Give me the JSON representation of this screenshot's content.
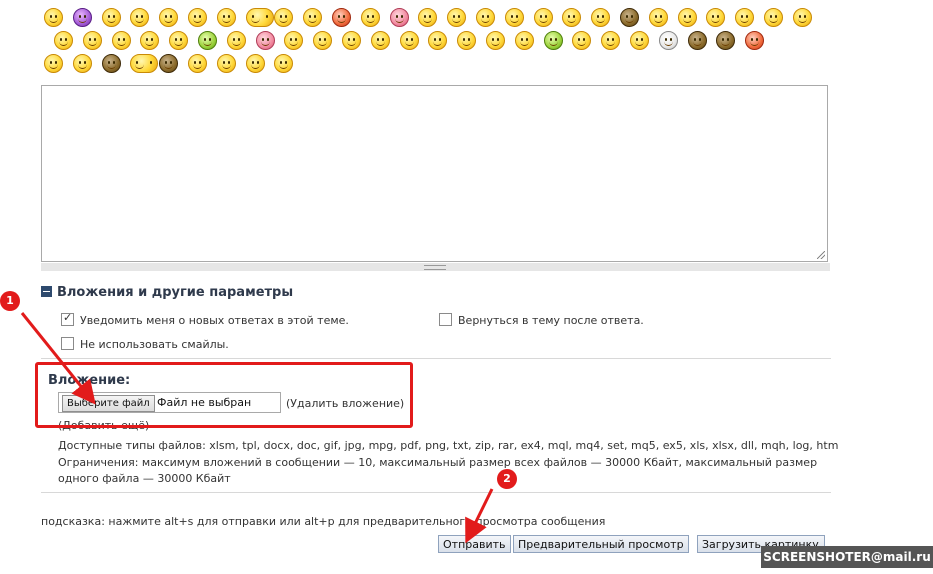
{
  "smileys": [
    {
      "kind": "yellow"
    },
    {
      "kind": "purple"
    },
    {
      "kind": "yellow"
    },
    {
      "kind": "yellow"
    },
    {
      "kind": "yellow"
    },
    {
      "kind": "yellow"
    },
    {
      "kind": "yellow"
    },
    {
      "kind": "yellow-wide"
    },
    {
      "kind": "yellow"
    },
    {
      "kind": "yellow"
    },
    {
      "kind": "red"
    },
    {
      "kind": "yellow"
    },
    {
      "kind": "pink"
    },
    {
      "kind": "yellow"
    },
    {
      "kind": "yellow"
    },
    {
      "kind": "yellow"
    },
    {
      "kind": "yellow"
    },
    {
      "kind": "yellow"
    },
    {
      "kind": "yellow"
    },
    {
      "kind": "yellow"
    },
    {
      "kind": "dark"
    },
    {
      "kind": "yellow"
    },
    {
      "kind": "yellow"
    },
    {
      "kind": "yellow"
    },
    {
      "kind": "yellow"
    },
    {
      "kind": "yellow"
    },
    {
      "kind": "yellow"
    },
    {
      "kind": "yellow"
    },
    {
      "kind": "yellow"
    },
    {
      "kind": "yellow"
    },
    {
      "kind": "yellow"
    },
    {
      "kind": "yellow"
    },
    {
      "kind": "green"
    },
    {
      "kind": "yellow"
    },
    {
      "kind": "pink"
    },
    {
      "kind": "yellow"
    },
    {
      "kind": "yellow"
    },
    {
      "kind": "yellow"
    },
    {
      "kind": "yellow"
    },
    {
      "kind": "yellow"
    },
    {
      "kind": "yellow"
    },
    {
      "kind": "yellow"
    },
    {
      "kind": "yellow"
    },
    {
      "kind": "yellow"
    },
    {
      "kind": "green"
    },
    {
      "kind": "yellow"
    },
    {
      "kind": "yellow"
    },
    {
      "kind": "yellow"
    },
    {
      "kind": "white"
    },
    {
      "kind": "dark"
    },
    {
      "kind": "dark"
    },
    {
      "kind": "red"
    },
    {
      "kind": "yellow"
    },
    {
      "kind": "yellow"
    },
    {
      "kind": "dark"
    },
    {
      "kind": "yellow-wide"
    },
    {
      "kind": "dark"
    },
    {
      "kind": "yellow"
    },
    {
      "kind": "yellow"
    },
    {
      "kind": "yellow"
    },
    {
      "kind": "yellow"
    }
  ],
  "message": {
    "value": ""
  },
  "options": {
    "title": "Вложения и другие параметры",
    "notify_label": "Уведомить меня о новых ответах в этой теме.",
    "notify_checked": true,
    "return_label": "Вернуться в тему после ответа.",
    "return_checked": false,
    "no_smileys_label": "Не использовать смайлы.",
    "no_smileys_checked": false
  },
  "attachment": {
    "title": "Вложение:",
    "choose_file_label": "Выберите файл",
    "file_status": "Файл не выбран",
    "remove_label": "(Удалить вложение)",
    "add_more_label": "(Добавить ещё)",
    "allowed_types": "Доступные типы файлов: xlsm, tpl, docx, doc, gif, jpg, mpg, pdf, png, txt, zip, rar, ex4, mql, mq4, set, mq5, ex5, xls, xlsx, dll, mqh, log, htm",
    "limits": "Ограничения: максимум вложений в сообщении — 10, максимальный размер всех файлов — 30000 Кбайт, максимальный размер одного файла — 30000 Кбайт"
  },
  "hint": "подсказка: нажмите alt+s для отправки или alt+p для предварительного просмотра сообщения",
  "buttons": {
    "submit": "Отправить",
    "preview": "Предварительный просмотр",
    "upload_image": "Загрузить картинку"
  },
  "annotations": {
    "marker1": "1",
    "marker2": "2",
    "color": "#e21b1b"
  },
  "watermark": "SCREENSHOTER@mail.ru"
}
